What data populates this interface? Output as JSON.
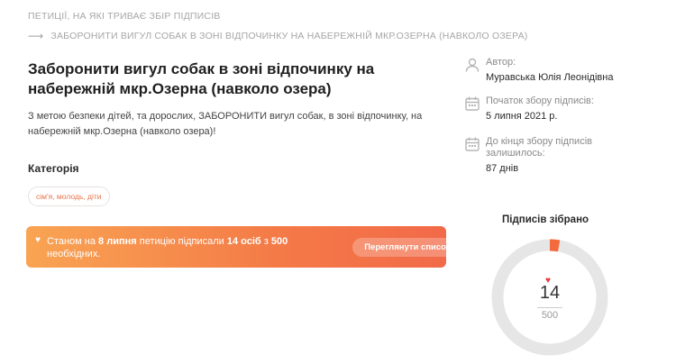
{
  "breadcrumb": {
    "top": "ПЕТИЦІЇ, НА ЯКІ ТРИВАЄ ЗБІР ПІДПИСІВ",
    "arrow": "⟶",
    "current": "ЗАБОРОНИТИ ВИГУЛ СОБАК В ЗОНІ ВІДПОЧИНКУ НА НАБЕРЕЖНІЙ МКР.ОЗЕРНА (НАВКОЛО ОЗЕРА)"
  },
  "petition": {
    "title": "Заборонити вигул собак в зоні відпочинку на набережній мкр.Озерна (навколо озера)",
    "description": "З метою безпеки дітей, та дорослих, ЗАБОРОНИТИ вигул собак, в зоні відпочинку, на набережній мкр.Озерна (навколо озера)!",
    "category_heading": "Категорія",
    "category_tag": "сім'я, молодь, діти"
  },
  "banner": {
    "text_1": "Станом на ",
    "date": "8 липня",
    "text_2": " петицію підписали ",
    "count": "14 осіб",
    "text_3": " з ",
    "target": "500",
    "text_4": " необхідних.",
    "button": "Переглянути список"
  },
  "info": {
    "author_label": "Автор:",
    "author_value": "Муравська Юлія Леонідівна",
    "start_label": "Початок збору підписів:",
    "start_value": "5 липня 2021 р.",
    "remaining_label": "До кінця збору підписів залишилось:",
    "remaining_value": "87 днів"
  },
  "gauge": {
    "title": "Підписів зібрано",
    "count": "14",
    "target": "500",
    "progress": 0.028
  },
  "colors": {
    "accent": "#f47a47",
    "gauge_track": "#e6e6e6",
    "gauge_fill": "#f26a3d",
    "heart": "#e8373f"
  },
  "icons": [
    "user-icon",
    "calendar-icon",
    "heart-icon"
  ]
}
